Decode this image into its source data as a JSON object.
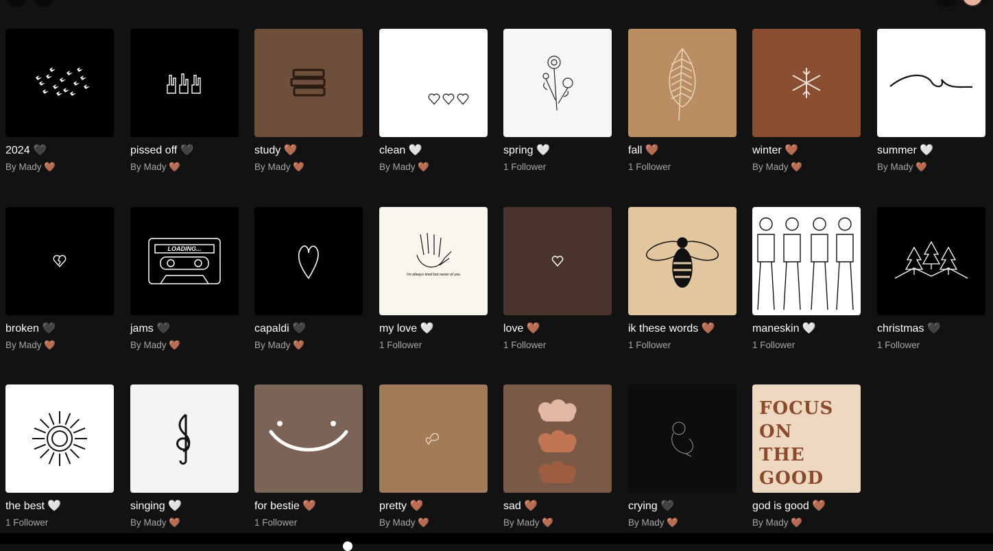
{
  "colors": {
    "background": "#121212",
    "subtitle": "#a7a7a7",
    "brown_heart": "#c98a6a"
  },
  "playlists": [
    {
      "title": "2024 🖤",
      "subtitle": "By Mady 🤎",
      "cover": "birds",
      "bg": "#000000"
    },
    {
      "title": "pissed off 🖤",
      "subtitle": "By Mady 🤎",
      "cover": "hands",
      "bg": "#000000"
    },
    {
      "title": "study 🤎",
      "subtitle": "By Mady 🤎",
      "cover": "books",
      "bg": "#6e4f3b"
    },
    {
      "title": "clean 🤍",
      "subtitle": "By Mady 🤎",
      "cover": "hearts",
      "bg": "#ffffff"
    },
    {
      "title": "spring 🤍",
      "subtitle": "1 Follower",
      "cover": "flowers",
      "bg": "#f6f6f4"
    },
    {
      "title": "fall 🤎",
      "subtitle": "1 Follower",
      "cover": "leaf",
      "bg": "#b88e62"
    },
    {
      "title": "winter 🤎",
      "subtitle": "By Mady 🤎",
      "cover": "snowflake",
      "bg": "#8a4f33"
    },
    {
      "title": "summer 🤍",
      "subtitle": "By Mady 🤎",
      "cover": "wave",
      "bg": "#ffffff"
    },
    {
      "title": "broken 🖤",
      "subtitle": "By Mady 🤎",
      "cover": "broken-heart",
      "bg": "#000000"
    },
    {
      "title": "jams 🖤",
      "subtitle": "By Mady 🤎",
      "cover": "cassette",
      "bg": "#000000",
      "cassette_text": "LOADING..."
    },
    {
      "title": "capaldi 🖤",
      "subtitle": "By Mady 🤎",
      "cover": "heart-outline",
      "bg": "#000000"
    },
    {
      "title": "my love 🤍",
      "subtitle": "1 Follower",
      "cover": "hand-sketch",
      "bg": "#f8f6ee",
      "caption": "i'm always tired but never of you"
    },
    {
      "title": "love 🤎",
      "subtitle": "1 Follower",
      "cover": "small-heart",
      "bg": "#4a332b"
    },
    {
      "title": "ik these words 🤎",
      "subtitle": "1 Follower",
      "cover": "bee",
      "bg": "#e2c69f"
    },
    {
      "title": "maneskin 🤍",
      "subtitle": "1 Follower",
      "cover": "band",
      "bg": "#ffffff"
    },
    {
      "title": "christmas 🖤",
      "subtitle": "1 Follower",
      "cover": "trees",
      "bg": "#000000"
    },
    {
      "title": "the best 🤍",
      "subtitle": "1 Follower",
      "cover": "sun",
      "bg": "#ffffff"
    },
    {
      "title": "singing 🤍",
      "subtitle": "By Mady 🤎",
      "cover": "treble-clef",
      "bg": "#f4f4f4"
    },
    {
      "title": "for bestie 🤎",
      "subtitle": "1 Follower",
      "cover": "smile",
      "bg": "#7c6358"
    },
    {
      "title": "pretty 🤎",
      "subtitle": "By Mady 🤎",
      "cover": "butterfly",
      "bg": "#a27b58"
    },
    {
      "title": "sad 🤎",
      "subtitle": "By Mady 🤎",
      "cover": "clouds",
      "bg": "#7a5a47"
    },
    {
      "title": "crying 🖤",
      "subtitle": "By Mady 🤎",
      "cover": "sad-figure",
      "bg": "#0d0d0d"
    },
    {
      "title": "god is good 🤎",
      "subtitle": "By Mady 🤎",
      "cover": "focus",
      "bg": "#efd8c1",
      "cover_lines": [
        "FOCUS",
        "ON",
        "THE",
        "GOOD"
      ]
    }
  ]
}
